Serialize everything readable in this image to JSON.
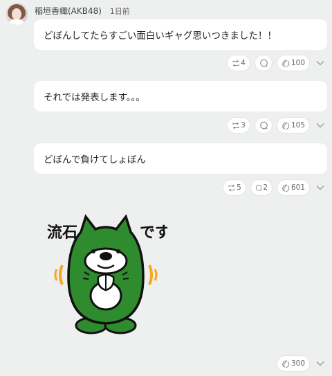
{
  "post": {
    "author": "稲垣香織(AKB48)",
    "time": "1日前"
  },
  "messages": [
    {
      "text": "どぼんしてたらすごい面白いギャグ思いつきました！！",
      "retweets": "4",
      "replies": "",
      "claps": "100"
    },
    {
      "text": "それでは発表します。。。",
      "retweets": "3",
      "replies": "",
      "claps": "105"
    },
    {
      "text": "どぼんで負けてしょぼん",
      "retweets": "5",
      "replies": "2",
      "claps": "601"
    }
  ],
  "sticker": {
    "caption_left": "流石",
    "caption_right": "です",
    "claps": "300"
  },
  "icons": {
    "retweet": "retweet-icon",
    "reply": "reply-bubble-icon",
    "clap": "clap-icon",
    "menu": "chevron-down-icon"
  },
  "colors": {
    "background": "#eeefef",
    "bubble": "#ffffff",
    "sticker_green": "#2e8b2e",
    "sticker_accent": "#f5a623"
  }
}
